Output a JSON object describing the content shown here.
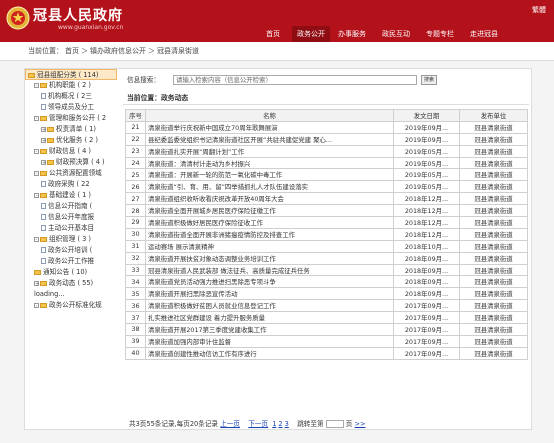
{
  "header": {
    "title": "冠县人民政府",
    "url": "www.guanxian.gov.cn",
    "lang": "繁體",
    "nav": [
      {
        "label": "首页",
        "active": false
      },
      {
        "label": "政务公开",
        "active": true
      },
      {
        "label": "办事服务",
        "active": false
      },
      {
        "label": "政民互动",
        "active": false
      },
      {
        "label": "专题专栏",
        "active": false
      },
      {
        "label": "走进冠县",
        "active": false
      }
    ]
  },
  "breadcrumb": [
    "当前位置：",
    "首页",
    "＞",
    "镇办政府信息公开",
    "＞",
    "冠县清泉街道"
  ],
  "sidebar": [
    {
      "label": "冠县组配分类 ( 114)",
      "lvl": 0,
      "icon": "fd",
      "sel": true
    },
    {
      "label": "机构职能 ( 2 )",
      "lvl": 1,
      "icon": "fd",
      "tog": "-"
    },
    {
      "label": "机构概况 ( 2三",
      "lvl": 2,
      "icon": "dc"
    },
    {
      "label": "领导成员及分工",
      "lvl": 2,
      "icon": "dc"
    },
    {
      "label": "管理和服务公开 ( 2",
      "lvl": 1,
      "icon": "fd",
      "tog": "-"
    },
    {
      "label": "权责清单 ( 1)",
      "lvl": 2,
      "icon": "fd",
      "tog": "+"
    },
    {
      "label": "优化服务 ( 2 )",
      "lvl": 2,
      "icon": "fd",
      "tog": "+"
    },
    {
      "label": "财政信息 ( 4 )",
      "lvl": 1,
      "icon": "fd",
      "tog": "-"
    },
    {
      "label": "财政预决算 ( 4 )",
      "lvl": 2,
      "icon": "fd",
      "tog": "+"
    },
    {
      "label": "公共资源配置领域",
      "lvl": 1,
      "icon": "fd",
      "tog": "-"
    },
    {
      "label": "政府采购 ( 22",
      "lvl": 2,
      "icon": "dc"
    },
    {
      "label": "基础建设 ( 1 )",
      "lvl": 1,
      "icon": "fd",
      "tog": "-"
    },
    {
      "label": "信息公开指南 (",
      "lvl": 2,
      "icon": "dc"
    },
    {
      "label": "信息公开年度报",
      "lvl": 2,
      "icon": "dc"
    },
    {
      "label": "主动公开基本目",
      "lvl": 2,
      "icon": "dc"
    },
    {
      "label": "组织管理 ( 3 )",
      "lvl": 1,
      "icon": "fd",
      "tog": "-"
    },
    {
      "label": "政务公开培训 (",
      "lvl": 2,
      "icon": "dc"
    },
    {
      "label": "政务公开工作推",
      "lvl": 2,
      "icon": "dc"
    },
    {
      "label": "通知公告 ( 10)",
      "lvl": 1,
      "icon": "fd"
    },
    {
      "label": "政务动态 ( 55)",
      "lvl": 1,
      "icon": "fd",
      "tog": "+"
    },
    {
      "label": "loading...",
      "lvl": 1,
      "icon": "none"
    },
    {
      "label": "政务公开标准化规",
      "lvl": 1,
      "icon": "fd",
      "tog": "-"
    }
  ],
  "search": {
    "label": "信息搜索：",
    "placeholder": "请输入检索内容（信息公开检索）",
    "button": "搜索"
  },
  "position": "当前位置：政务动态",
  "table": {
    "headers": [
      "序号",
      "名称",
      "发文日期",
      "发布单位"
    ],
    "rows": [
      [
        "21",
        "清泉街道举行庆祝新中国成立70周年歌舞展演",
        "2019年09月...",
        "冠县清泉街道"
      ],
      [
        "22",
        "县纪委监委党组织书记清泉街道社区开展“共驻共建促党建 聚心...",
        "2019年09月...",
        "冠县清泉街道"
      ],
      [
        "23",
        "清泉街道扎实开展“周翻计划”工作",
        "2019年05月...",
        "冠县清泉街道"
      ],
      [
        "24",
        "清泉街道：清清村计走动为乡村振兴",
        "2019年05月...",
        "冠县清泉街道"
      ],
      [
        "25",
        "清泉街道：开展新一轮的防范一氧化碳中毒工作",
        "2019年05月...",
        "冠县清泉街道"
      ],
      [
        "26",
        "清泉街道“引、育、用、留”四举措抓扎人才队伍建设落实",
        "2019年05月...",
        "冠县清泉街道"
      ],
      [
        "27",
        "清泉街道组织收听收看庆祝改革开放40周年大会",
        "2018年12月...",
        "冠县清泉街道"
      ],
      [
        "28",
        "清泉街道全面开展城乡居民医疗保险征缴工作",
        "2018年12月...",
        "冠县清泉街道"
      ],
      [
        "29",
        "清泉街道积极做好居民医疗保险征收工作",
        "2018年12月...",
        "冠县清泉街道"
      ],
      [
        "30",
        "清泉街道街道全面开展非洲猪瘟疫情防控及排查工作",
        "2018年12月...",
        "冠县清泉街道"
      ],
      [
        "31",
        "运动赛场 展示清泉精神",
        "2018年10月...",
        "冠县清泉街道"
      ],
      [
        "32",
        "清泉街道开展扶贫对象动态调整业务培训工作",
        "2018年09月...",
        "冠县清泉街道"
      ],
      [
        "33",
        "冠县清泉街道人民武装部 做法征兵、高质量完成征兵任务",
        "2018年09月...",
        "冠县清泉街道"
      ],
      [
        "34",
        "清泉街道党员活动强力推进扫黑除恶专项斗争",
        "2018年09月...",
        "冠县清泉街道"
      ],
      [
        "35",
        "清泉街道开展扫黑除恶宣传活动",
        "2018年09月...",
        "冠县清泉街道"
      ],
      [
        "36",
        "清泉街道积极做好贫困人员就业信息登记工作",
        "2017年09月...",
        "冠县清泉街道"
      ],
      [
        "37",
        "扎实推进社区党群建设 着力提升服务质量",
        "2017年09月...",
        "冠县清泉街道"
      ],
      [
        "38",
        "清泉街道开展2017第三季度党建收集工作",
        "2017年09月...",
        "冠县清泉街道"
      ],
      [
        "39",
        "清泉街道加强内部审计住监督",
        "2017年09月...",
        "冠县清泉街道"
      ],
      [
        "40",
        "清泉街道创建性推动信访工作有序进行",
        "2017年09月...",
        "冠县清泉街道"
      ]
    ]
  },
  "pager": {
    "summary": "共3页55条记录,每页20条记录",
    "prev": "上一页",
    "next": "下一页",
    "pages": [
      "1",
      "2",
      "3"
    ],
    "jump": "跳转至第",
    "unit": "页",
    "go": ">>"
  },
  "colors": {
    "brand": "#b3121b",
    "nav_active": "#8e0c12"
  },
  "icons": [
    "emblem-icon",
    "folder-icon",
    "document-icon",
    "toggle-icon"
  ]
}
